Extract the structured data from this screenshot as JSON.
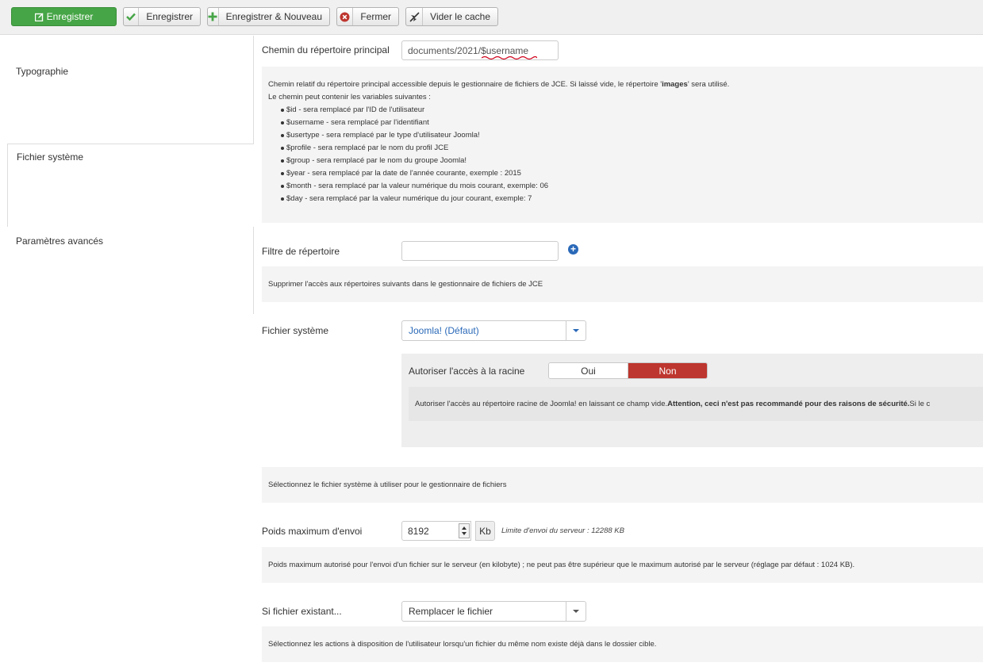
{
  "toolbar": {
    "save_primary": "Enregistrer",
    "save": "Enregistrer",
    "save_new": "Enregistrer & Nouveau",
    "close": "Fermer",
    "clear_cache": "Vider le cache"
  },
  "sidebar": {
    "tabs": [
      "Typographie",
      "Fichier système",
      "Paramètres avancés"
    ],
    "active_tab": "Fichier système"
  },
  "fields": {
    "root_dir": {
      "label": "Chemin du répertoire principal",
      "value": "documents/2021/$username",
      "desc_line1_pre": "Chemin relatif du répertoire principal accessible depuis le gestionnaire de fichiers de JCE. Si laissé vide, le répertoire '",
      "desc_line1_bold": "images",
      "desc_line1_post": "' sera utilisé.",
      "desc_line2": "Le chemin peut contenir les variables suivantes :",
      "variables": [
        "$id - sera remplacé par l'ID de l'utilisateur",
        "$username - sera remplacé par l'identifiant",
        "$usertype - sera remplacé par le type d'utilisateur Joomla!",
        "$profile - sera remplacé par le nom du profil JCE",
        "$group - sera remplacé par le nom du groupe Joomla!",
        "$year - sera remplacé par la date de l'année courante, exemple : 2015",
        "$month - sera remplacé par la valeur numérique du mois courant, exemple: 06",
        "$day - sera remplacé par la valeur numérique du jour courant, exemple: 7"
      ]
    },
    "dir_filter": {
      "label": "Filtre de répertoire",
      "value": "",
      "desc": "Supprimer l'accès aux répertoires suivants dans le gestionnaire de fichiers de JCE"
    },
    "filesystem": {
      "label": "Fichier système",
      "selected": "Joomla! (Défaut)",
      "desc": "Sélectionnez le fichier système à utiliser pour le gestionnaire de fichiers",
      "root_access": {
        "label": "Autoriser l'accès à la racine",
        "yes": "Oui",
        "no": "Non",
        "selected": "Non",
        "desc_pre": "Autoriser l'accès au répertoire racine de Joomla! en laissant ce champ vide. ",
        "desc_bold": "Attention, ceci n'est pas recommandé pour des raisons de sécurité.",
        "desc_post": "Si le c"
      }
    },
    "max_upload": {
      "label": "Poids maximum d'envoi",
      "value": "8192",
      "unit": "Kb",
      "limit_note": "Limite d'envoi du serveur : 12288 KB",
      "desc": "Poids maximum autorisé pour l'envoi d'un fichier sur le serveur (en kilobyte) ; ne peut pas être supérieur que le maximum autorisé par le serveur (réglage par défaut : 1024 KB)."
    },
    "if_exists": {
      "label": "Si fichier existant...",
      "selected": "Remplacer le fichier",
      "desc": "Sélectionnez les actions à disposition de l'utilisateur lorsqu'un fichier du même nom existe déjà dans le dossier cible."
    }
  },
  "colors": {
    "primary_green": "#46a546",
    "danger_red": "#bd362f",
    "link_blue": "#2a69b8"
  }
}
